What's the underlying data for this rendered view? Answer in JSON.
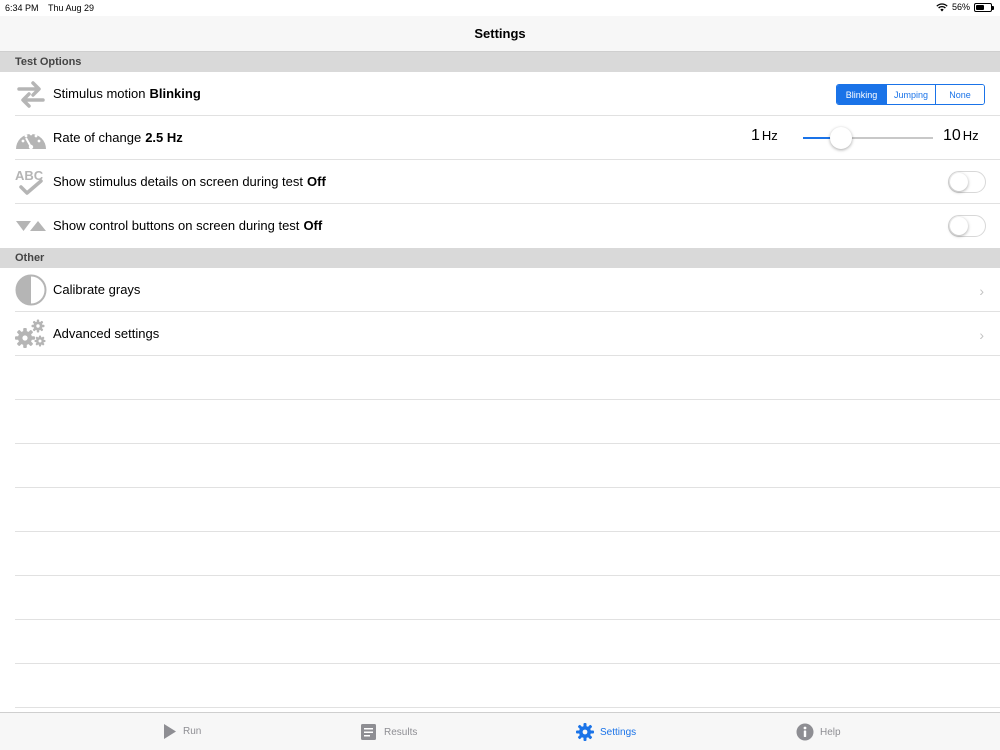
{
  "status": {
    "time": "6:34 PM",
    "date": "Thu Aug 29",
    "battery": "56%",
    "battery_level": 0.56
  },
  "nav": {
    "title": "Settings"
  },
  "sections": {
    "test_options": "Test Options",
    "other": "Other"
  },
  "stimulus_motion": {
    "label": "Stimulus motion",
    "value": "Blinking",
    "options": [
      "Blinking",
      "Jumping",
      "None"
    ],
    "selected": "Blinking"
  },
  "rate_of_change": {
    "label": "Rate of change",
    "value": "2.5 Hz",
    "min_num": "1",
    "max_num": "10",
    "unit": "Hz",
    "slider_value": 2.5,
    "slider_min": 1,
    "slider_max": 10
  },
  "stimulus_details": {
    "label": "Show stimulus details on screen during test",
    "value": "Off"
  },
  "control_buttons": {
    "label": "Show control buttons on screen during test",
    "value": "Off"
  },
  "calibrate": {
    "label": "Calibrate grays"
  },
  "advanced": {
    "label": "Advanced settings"
  },
  "tabs": [
    {
      "label": "Run",
      "icon": "play-icon"
    },
    {
      "label": "Results",
      "icon": "document-icon"
    },
    {
      "label": "Settings",
      "icon": "gear-icon"
    },
    {
      "label": "Help",
      "icon": "info-icon"
    }
  ],
  "colors": {
    "accent": "#1a73e8",
    "section_bg": "#d9d9d9",
    "icon_gray": "#b5b5b5"
  }
}
